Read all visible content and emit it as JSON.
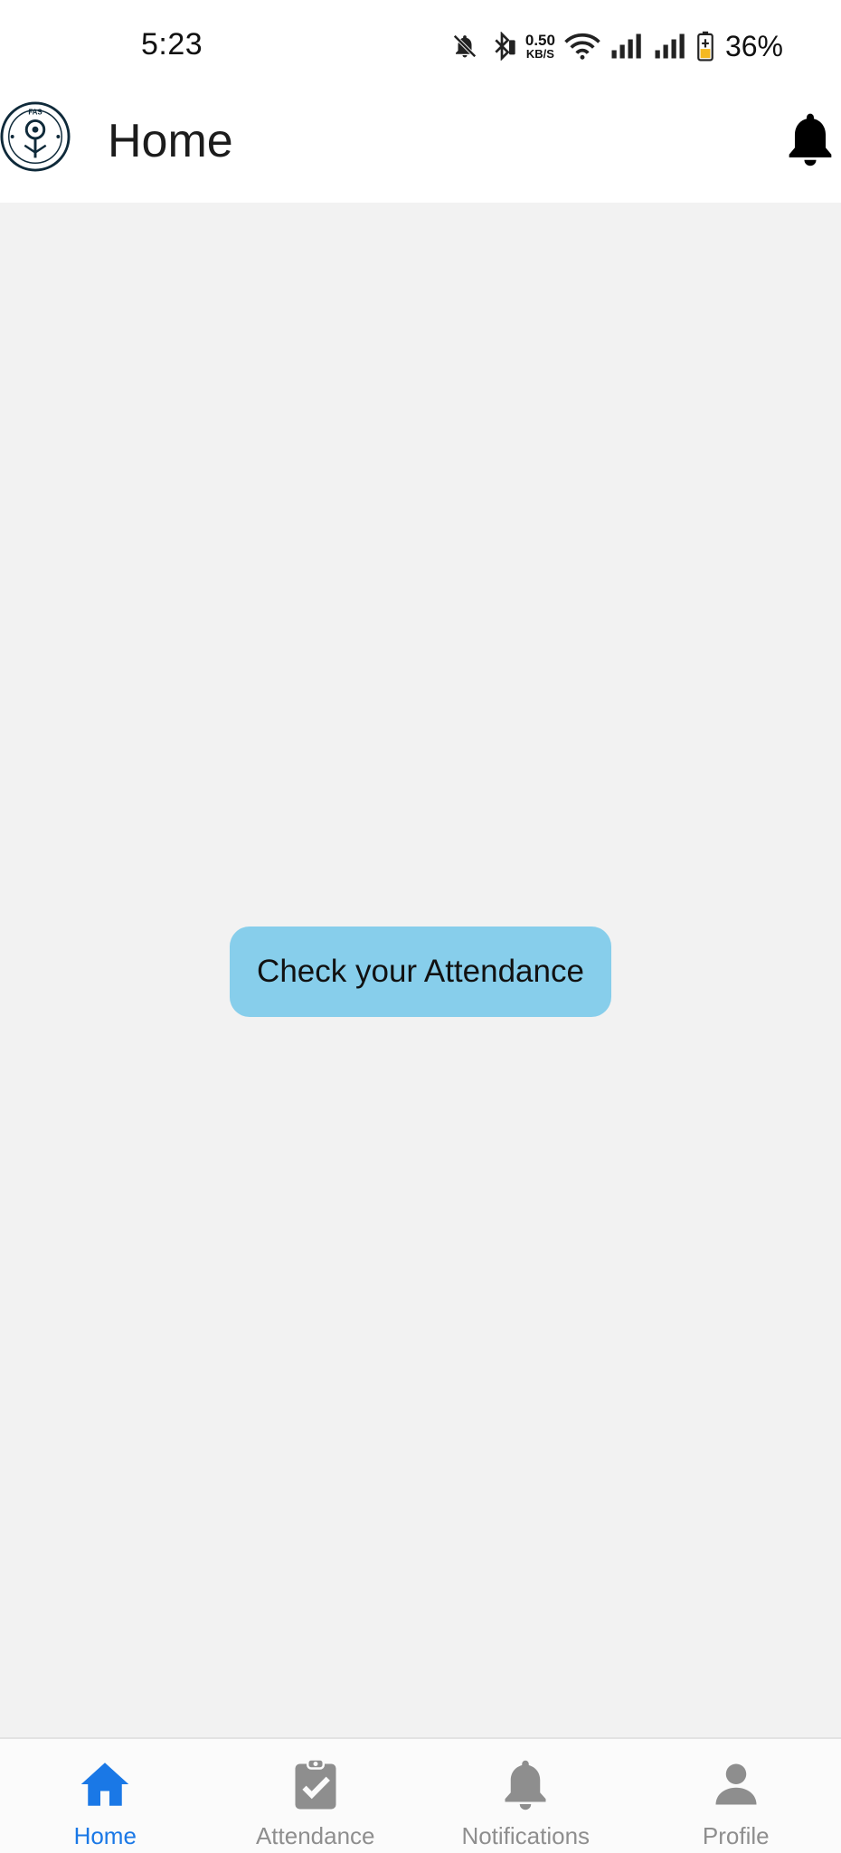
{
  "status_bar": {
    "time": "5:23",
    "net_speed_value": "0.50",
    "net_speed_unit": "KB/S",
    "battery_percent": "36%",
    "icons": [
      "bell-off-icon",
      "bluetooth-icon",
      "wifi-icon",
      "signal-icon",
      "signal-icon",
      "battery-charging-icon"
    ]
  },
  "app_bar": {
    "title": "Home",
    "logo_text": "FAS",
    "logo_icon": "app-logo",
    "action_icon": "bell-icon"
  },
  "main": {
    "primary_button_label": "Check your Attendance",
    "primary_button_color": "#87ceeb"
  },
  "bottom_nav": {
    "active_color": "#1a78e6",
    "inactive_color": "#8e8e8e",
    "items": [
      {
        "label": "Home",
        "icon": "home-icon",
        "active": true
      },
      {
        "label": "Attendance",
        "icon": "clipboard-check-icon",
        "active": false
      },
      {
        "label": "Notifications",
        "icon": "bell-icon",
        "active": false
      },
      {
        "label": "Profile",
        "icon": "person-icon",
        "active": false
      }
    ]
  }
}
